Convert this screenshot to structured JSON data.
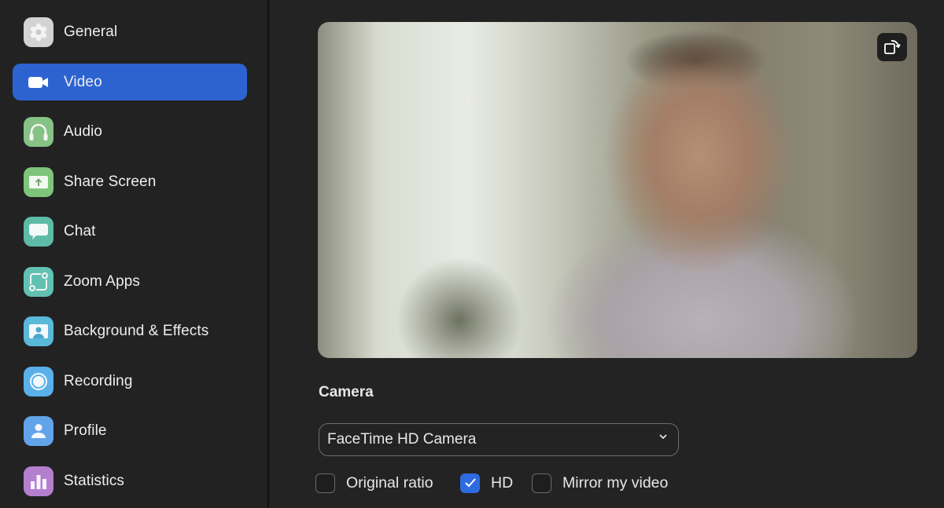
{
  "sidebar": {
    "items": [
      {
        "label": "General",
        "icon": "gear-icon",
        "icon_color": "#d3d3d3",
        "active": false
      },
      {
        "label": "Video",
        "icon": "video-camera-icon",
        "icon_color": "#2d63d1",
        "active": true
      },
      {
        "label": "Audio",
        "icon": "headphones-icon",
        "icon_color": "#86c185",
        "active": false
      },
      {
        "label": "Share Screen",
        "icon": "share-screen-icon",
        "icon_color": "#7ec47b",
        "active": false
      },
      {
        "label": "Chat",
        "icon": "chat-bubble-icon",
        "icon_color": "#5dbba8",
        "active": false
      },
      {
        "label": "Zoom Apps",
        "icon": "zoom-apps-icon",
        "icon_color": "#62c1b2",
        "active": false
      },
      {
        "label": "Background & Effects",
        "icon": "background-icon",
        "icon_color": "#5ab8d8",
        "active": false
      },
      {
        "label": "Recording",
        "icon": "record-icon",
        "icon_color": "#5ab0ea",
        "active": false
      },
      {
        "label": "Profile",
        "icon": "profile-icon",
        "icon_color": "#62a4ea",
        "active": false
      },
      {
        "label": "Statistics",
        "icon": "statistics-icon",
        "icon_color": "#b57fd0",
        "active": false
      }
    ],
    "active_color": "#2d63d1"
  },
  "main": {
    "preview": {
      "description": "Live camera preview",
      "rotate_icon": "rotate-camera-icon"
    },
    "camera": {
      "title": "Camera",
      "selected": "FaceTime HD Camera"
    },
    "options": [
      {
        "label": "Original ratio",
        "checked": false
      },
      {
        "label": "HD",
        "checked": true
      },
      {
        "label": "Mirror my video",
        "checked": false
      }
    ],
    "checkbox_accent": "#2e6be0"
  }
}
